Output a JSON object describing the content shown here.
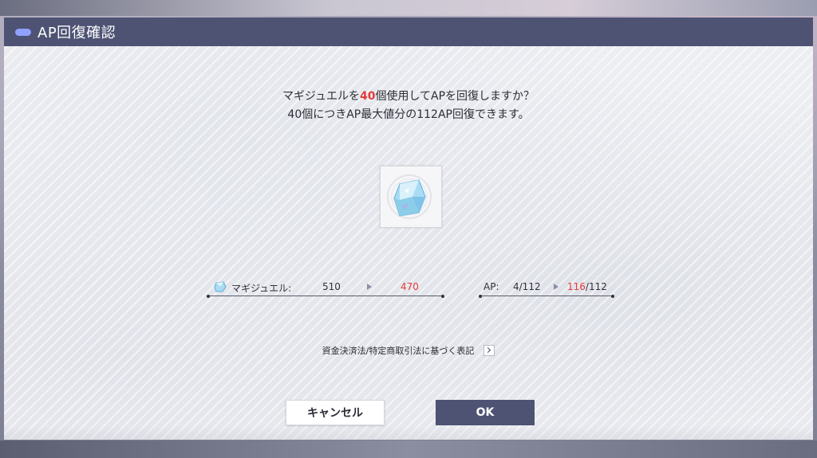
{
  "dialog": {
    "title": "AP回復確認",
    "message_line1_prefix": "マギジュエルを",
    "message_line1_highlight": "40",
    "message_line1_suffix": "個使用してAPを回復しますか？",
    "message_line2": "40個につきAP最大値分の112AP回復できます。",
    "item_icon": "magi-jewel-icon",
    "jewel_stat": {
      "label": "マギジュエル:",
      "current": "510",
      "after": "470"
    },
    "ap_stat": {
      "label": "AP:",
      "current": "4/112",
      "after_value": "116",
      "after_max": "/112"
    },
    "legal_link": "資金決済法/特定商取引法に基づく表記",
    "cancel_label": "キャンセル",
    "ok_label": "OK"
  },
  "colors": {
    "titlebar": "#4e5374",
    "highlight": "#e23a3a",
    "ok_button": "#4e5374",
    "pill_accent": "#8fa2ff"
  }
}
